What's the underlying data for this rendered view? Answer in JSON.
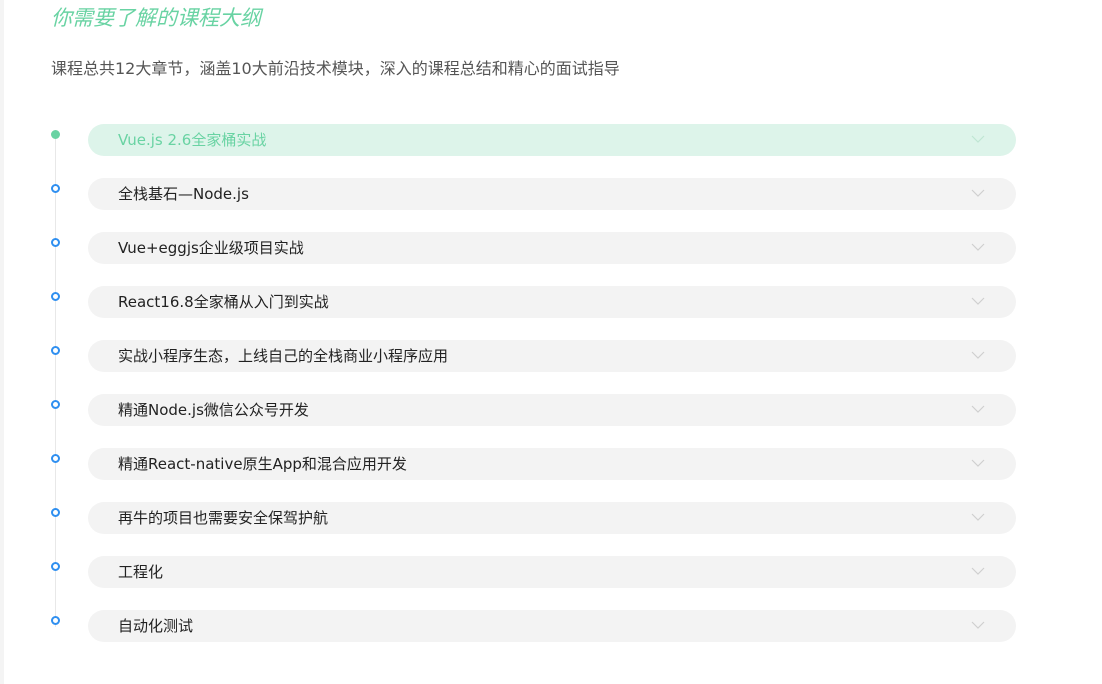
{
  "header": {
    "title": "你需要了解的课程大纲",
    "subtitle": "课程总共12大章节，涵盖10大前沿技术模块，深入的课程总结和精心的面试指导"
  },
  "colors": {
    "accent": "#69d3a3",
    "dot": "#2f8ff0",
    "pill_bg": "#f3f3f3",
    "pill_active_bg": "#ddf4ea"
  },
  "chapters": [
    {
      "label": "Vue.js 2.6全家桶实战",
      "active": true,
      "icon": "chevron-down-icon"
    },
    {
      "label": "全栈基石—Node.js",
      "active": false,
      "icon": "chevron-down-icon"
    },
    {
      "label": "Vue+eggjs企业级项目实战",
      "active": false,
      "icon": "chevron-down-icon"
    },
    {
      "label": "React16.8全家桶从入门到实战",
      "active": false,
      "icon": "chevron-down-icon"
    },
    {
      "label": "实战小程序生态，上线自己的全栈商业小程序应用",
      "active": false,
      "icon": "chevron-down-icon"
    },
    {
      "label": "精通Node.js微信公众号开发",
      "active": false,
      "icon": "chevron-down-icon"
    },
    {
      "label": "精通React-native原生App和混合应用开发",
      "active": false,
      "icon": "chevron-down-icon"
    },
    {
      "label": "再牛的项目也需要安全保驾护航",
      "active": false,
      "icon": "chevron-down-icon"
    },
    {
      "label": "工程化",
      "active": false,
      "icon": "chevron-down-icon"
    },
    {
      "label": "自动化测试",
      "active": false,
      "icon": "chevron-down-icon"
    }
  ]
}
